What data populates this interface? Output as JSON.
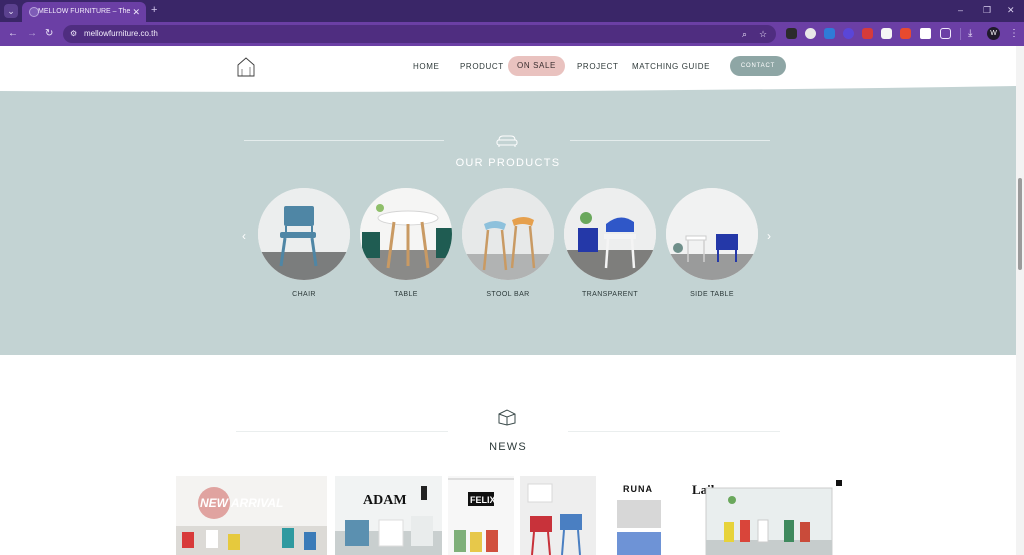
{
  "browser": {
    "tab_title": "MELLOW FURNITURE – The sim",
    "close_symbol": "✕",
    "new_tab_symbol": "+",
    "url": "mellowfurniture.co.th",
    "nav": {
      "back": "←",
      "forward": "→",
      "reload": "↻"
    },
    "window": {
      "minimize": "–",
      "restore": "❐",
      "close": "✕"
    },
    "profile_initial": "W",
    "extensions": [
      "ext-1",
      "ext-2",
      "ext-3",
      "ext-4",
      "ext-5",
      "ext-6",
      "ext-7",
      "ext-8"
    ]
  },
  "header": {
    "nav_items": [
      "HOME",
      "PRODUCT",
      "ON SALE",
      "PROJECT",
      "MATCHING GUIDE"
    ],
    "contact": "CONTACT"
  },
  "products_section": {
    "title": "OUR PRODUCTS",
    "prev_arrow": "‹",
    "next_arrow": "›",
    "items": [
      {
        "label": "CHAIR"
      },
      {
        "label": "TABLE"
      },
      {
        "label": "STOOL BAR"
      },
      {
        "label": "TRANSPARENT"
      },
      {
        "label": "SIDE TABLE"
      }
    ]
  },
  "news_section": {
    "title": "NEWS",
    "cards": [
      {
        "text": "NEW ARRIVAL"
      },
      {
        "text": "ADAM"
      },
      {
        "text": "FELIX"
      },
      {
        "text": ""
      },
      {
        "text": "RUNA"
      },
      {
        "text": "Laila"
      }
    ]
  },
  "colors": {
    "browser_tabbar": "#3a2668",
    "browser_toolbar": "#6b3fa5",
    "products_band": "#c3d3d3",
    "sale_pill": "#e9c2bf",
    "contact_button": "#8ea6a5"
  }
}
